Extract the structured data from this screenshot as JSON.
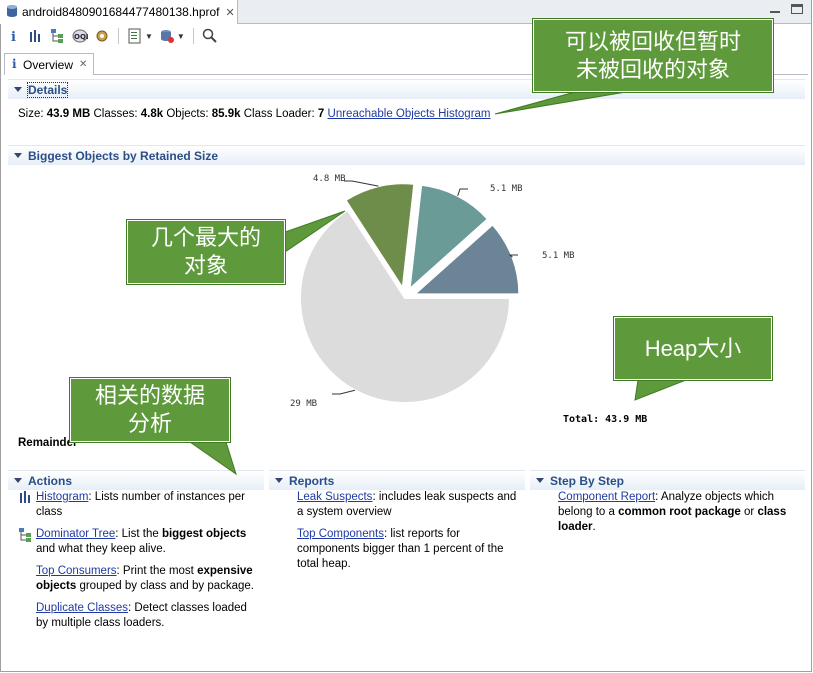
{
  "editor": {
    "file_tab_label": "android8480901684477480138.hprof",
    "close_symbol": "✕"
  },
  "inner_tab": {
    "label": "Overview",
    "close_symbol": "✕"
  },
  "details": {
    "title": "Details",
    "size_label": "Size:",
    "size_value": "43.9 MB",
    "classes_label": "Classes:",
    "classes_value": "4.8k",
    "objects_label": "Objects:",
    "objects_value": "85.9k",
    "classloader_label": "Class Loader:",
    "classloader_value": "7",
    "unreachable_link": "Unreachable Objects Histogram"
  },
  "biggest": {
    "title": "Biggest Objects by Retained Size",
    "remainder_label": "Remainder",
    "total_label": "Total: 43.9 MB"
  },
  "chart_data": {
    "type": "pie",
    "unit": "MB",
    "slices": [
      {
        "label": "5.1 MB",
        "value": 5.1,
        "color": "#6b8596"
      },
      {
        "label": "5.1 MB",
        "value": 5.1,
        "color": "#6a9b97"
      },
      {
        "label": "4.8 MB",
        "value": 4.8,
        "color": "#6f8d4a"
      },
      {
        "label": "29 MB",
        "value": 28.9,
        "color": "#dcdcdc"
      }
    ],
    "total": "Total: 43.9 MB"
  },
  "callouts": {
    "unreachable": [
      "可以被回收但暂时",
      "未被回收的对象"
    ],
    "biggest": [
      "几个最大的",
      "对象"
    ],
    "heap": [
      "Heap大小"
    ],
    "analysis": [
      "相关的数据",
      "分析"
    ]
  },
  "actions": {
    "title": "Actions",
    "items": [
      {
        "link": "Histogram",
        "text": ": Lists number of instances per class",
        "icon": "histogram-icon"
      },
      {
        "link": "Dominator Tree",
        "text_pre": ": List the ",
        "bold": "biggest objects",
        "text_post": " and what they keep alive.",
        "icon": "dominator-tree-icon"
      },
      {
        "link": "Top Consumers",
        "text_pre": ": Print the most ",
        "bold": "expensive objects",
        "text_post": " grouped by class and by package."
      },
      {
        "link": "Duplicate Classes",
        "text": ": Detect classes loaded by multiple class loaders."
      }
    ]
  },
  "reports": {
    "title": "Reports",
    "items": [
      {
        "link": "Leak Suspects",
        "text": ": includes leak suspects and a system overview"
      },
      {
        "link": "Top Components",
        "text": ": list reports for components bigger than 1 percent of the total heap."
      }
    ]
  },
  "steps": {
    "title": "Step By Step",
    "items": [
      {
        "link": "Component Report",
        "text_pre": ": Analyze objects which belong to a ",
        "bold1": "common root package",
        "text_mid": " or ",
        "bold2": "class loader",
        "text_post": "."
      }
    ]
  },
  "colors": {
    "callout_green": "#5e9a3b",
    "link_blue": "#1f3aa5",
    "section_title": "#2a4f86"
  }
}
